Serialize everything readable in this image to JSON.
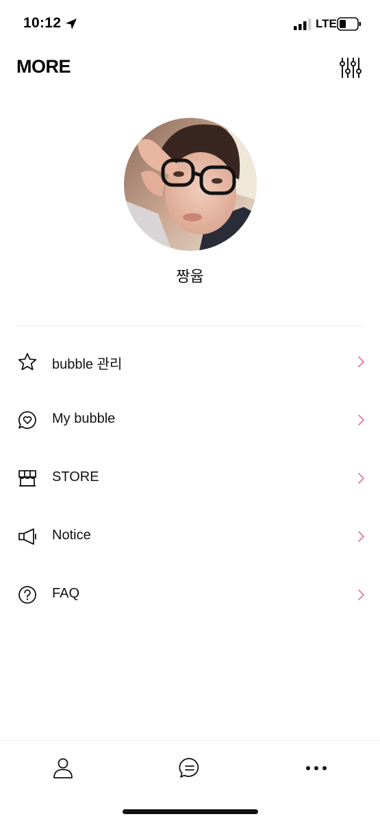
{
  "status_bar": {
    "time": "10:12",
    "network": "LTE"
  },
  "header": {
    "title": "MORE"
  },
  "profile": {
    "name": "짱윱"
  },
  "menu": {
    "items": [
      {
        "label": "bubble 관리",
        "icon": "star-icon"
      },
      {
        "label": "My bubble",
        "icon": "heart-bubble-icon"
      },
      {
        "label": "STORE",
        "icon": "store-icon"
      },
      {
        "label": "Notice",
        "icon": "megaphone-icon"
      },
      {
        "label": "FAQ",
        "icon": "question-icon"
      }
    ]
  },
  "bottom_nav": {
    "items": [
      "profile-icon",
      "chat-icon",
      "more-dots-icon"
    ]
  },
  "colors": {
    "chevron": "#e8769a",
    "text": "#111111",
    "divider": "#ececec"
  }
}
